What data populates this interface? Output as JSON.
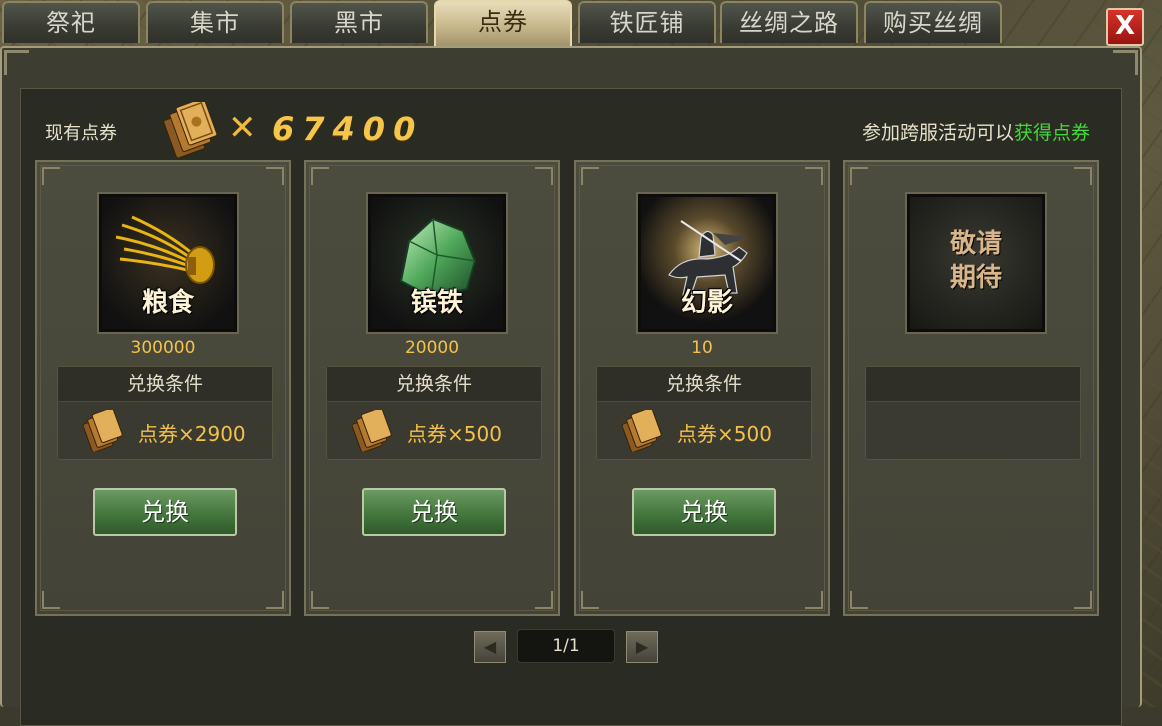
{
  "tabs": [
    {
      "label": "祭祀",
      "active": false
    },
    {
      "label": "集市",
      "active": false
    },
    {
      "label": "黑市",
      "active": false
    },
    {
      "label": "点券",
      "active": true
    },
    {
      "label": "铁匠铺",
      "active": false
    },
    {
      "label": "丝绸之路",
      "active": false
    },
    {
      "label": "购买丝绸",
      "active": false
    }
  ],
  "close_label": "X",
  "currency": {
    "label": "现有点券",
    "multiplier": "✕",
    "amount": "67400"
  },
  "hint": {
    "prefix": "参加跨服活动可以",
    "link": "获得点券"
  },
  "items": [
    {
      "icon": "grain-icon",
      "name": "粮食",
      "quantity": "300000",
      "condition_title": "兑换条件",
      "cost": "点券×2900",
      "button": "兑换"
    },
    {
      "icon": "iron-ore-icon",
      "name": "镔铁",
      "quantity": "20000",
      "condition_title": "兑换条件",
      "cost": "点券×500",
      "button": "兑换"
    },
    {
      "icon": "phantom-rider-icon",
      "name": "幻影",
      "quantity": "10",
      "condition_title": "兑换条件",
      "cost": "点券×500",
      "button": "兑换"
    }
  ],
  "coming_soon": {
    "line1": "敬请",
    "line2": "期待"
  },
  "pager": {
    "prev": "◀",
    "next": "▶",
    "current": "1/1"
  },
  "colors": {
    "accent_gold": "#f4c24c",
    "hint_green": "#44d83a",
    "button_green": "#477a40",
    "close_red": "#c0241c"
  }
}
